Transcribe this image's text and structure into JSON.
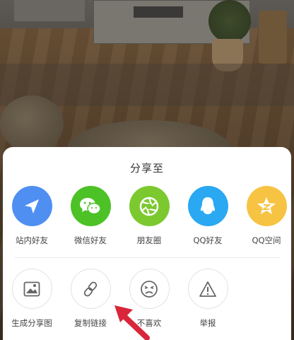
{
  "share_sheet": {
    "title": "分享至",
    "row1": [
      {
        "label": "站内好友",
        "icon": "send-icon",
        "color": "#4f8ff2"
      },
      {
        "label": "微信好友",
        "icon": "wechat-icon",
        "color": "#4cc226"
      },
      {
        "label": "朋友圈",
        "icon": "moments-icon",
        "color": "#7bc92f"
      },
      {
        "label": "QQ好友",
        "icon": "qq-icon",
        "color": "#2aa8f2"
      },
      {
        "label": "QQ空间",
        "icon": "qzone-icon",
        "color": "#f6c343"
      }
    ],
    "row2": [
      {
        "label": "生成分享图",
        "icon": "image-icon"
      },
      {
        "label": "复制链接",
        "icon": "link-icon"
      },
      {
        "label": "不喜欢",
        "icon": "dislike-face-icon"
      },
      {
        "label": "举报",
        "icon": "warning-icon"
      }
    ]
  },
  "annotation": {
    "arrow_color": "#d9263a"
  }
}
